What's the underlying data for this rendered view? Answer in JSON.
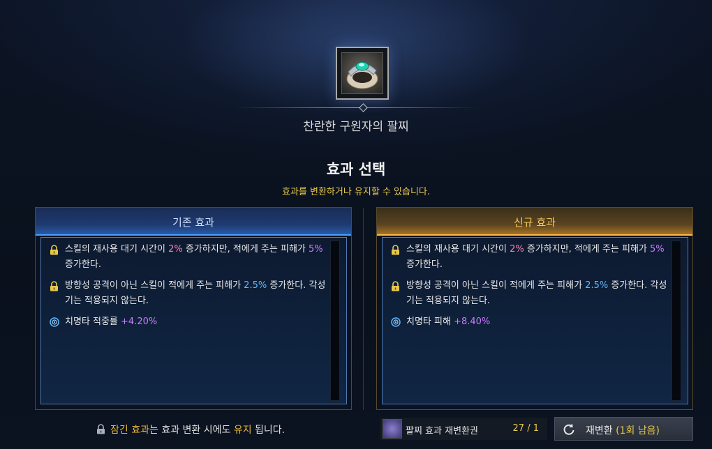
{
  "item": {
    "name": "찬란한 구원자의 팔찌",
    "icon": "bracelet-icon"
  },
  "selection": {
    "title": "효과 선택",
    "subtitle": "효과를 변환하거나 유지할 수 있습니다."
  },
  "current": {
    "header": "기존 효과",
    "effects": [
      {
        "icon": "lock-icon",
        "part1": "스킬의 재사용 대기 시간이 ",
        "v1": "2%",
        "part2": " 증가하지만, 적에게 주는 피해가 ",
        "v2": "5%",
        "part3": " 증가한다."
      },
      {
        "icon": "lock-icon",
        "part1": "방향성 공격이 아닌 스킬이 적에게 주는 피해가 ",
        "v1": "2.5%",
        "part2": " 증가한다. 각성기는 적용되지 않는다."
      },
      {
        "icon": "stat-swirl-icon",
        "label": "치명타 적중률 ",
        "value": "+4.20%"
      }
    ]
  },
  "new": {
    "header": "신규 효과",
    "effects": [
      {
        "icon": "lock-icon",
        "part1": "스킬의 재사용 대기 시간이 ",
        "v1": "2%",
        "part2": " 증가하지만, 적에게 주는 피해가 ",
        "v2": "5%",
        "part3": " 증가한다."
      },
      {
        "icon": "lock-icon",
        "part1": "방향성 공격이 아닌 스킬이 적에게 주는 피해가 ",
        "v1": "2.5%",
        "part2": " 증가한다. 각성기는 적용되지 않는다."
      },
      {
        "icon": "stat-swirl-icon",
        "label": "치명타 피해 ",
        "value": "+8.40%"
      }
    ]
  },
  "footer": {
    "note_part1": "잠긴 효과",
    "note_part2": "는 효과 변환 시에도 ",
    "note_part3": "유지",
    "note_part4": " 됩니다.",
    "reroll_item_name": "팔찌 효과 재변환권",
    "reroll_item_count": "27 / 1",
    "reroll_button_label": "재변환 ",
    "reroll_button_remaining": "(1회 남음)"
  },
  "colors": {
    "accent_gold": "#e7c84c",
    "current_header": "#2a5fb0",
    "new_header": "#b07a25",
    "value_pink": "#ff7fb8",
    "value_purple": "#c77dff",
    "value_blue": "#5fb8ff"
  }
}
